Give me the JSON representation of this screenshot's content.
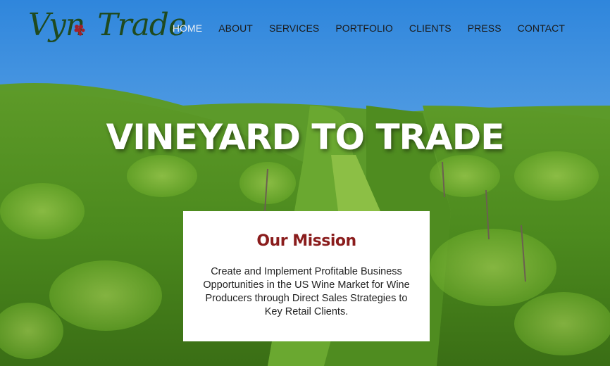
{
  "logo": {
    "text_left": "Vyn",
    "text_right": "Trade"
  },
  "nav": [
    {
      "label": "HOME",
      "active": true
    },
    {
      "label": "ABOUT"
    },
    {
      "label": "SERVICES"
    },
    {
      "label": "PORTFOLIO"
    },
    {
      "label": "CLIENTS"
    },
    {
      "label": "PRESS"
    },
    {
      "label": "CONTACT"
    }
  ],
  "hero": {
    "title": "VINEYARD TO TRADE"
  },
  "mission": {
    "heading": "Our Mission",
    "body": "Create and Implement Profitable Business Opportunities in the US Wine Market for Wine Producers through Direct Sales Strategies to Key Retail Clients."
  },
  "colors": {
    "accent": "#8a1c1c",
    "logo_green": "#1f4a1f",
    "sky": "#3a8fd8",
    "vine": "#4f8a22"
  }
}
